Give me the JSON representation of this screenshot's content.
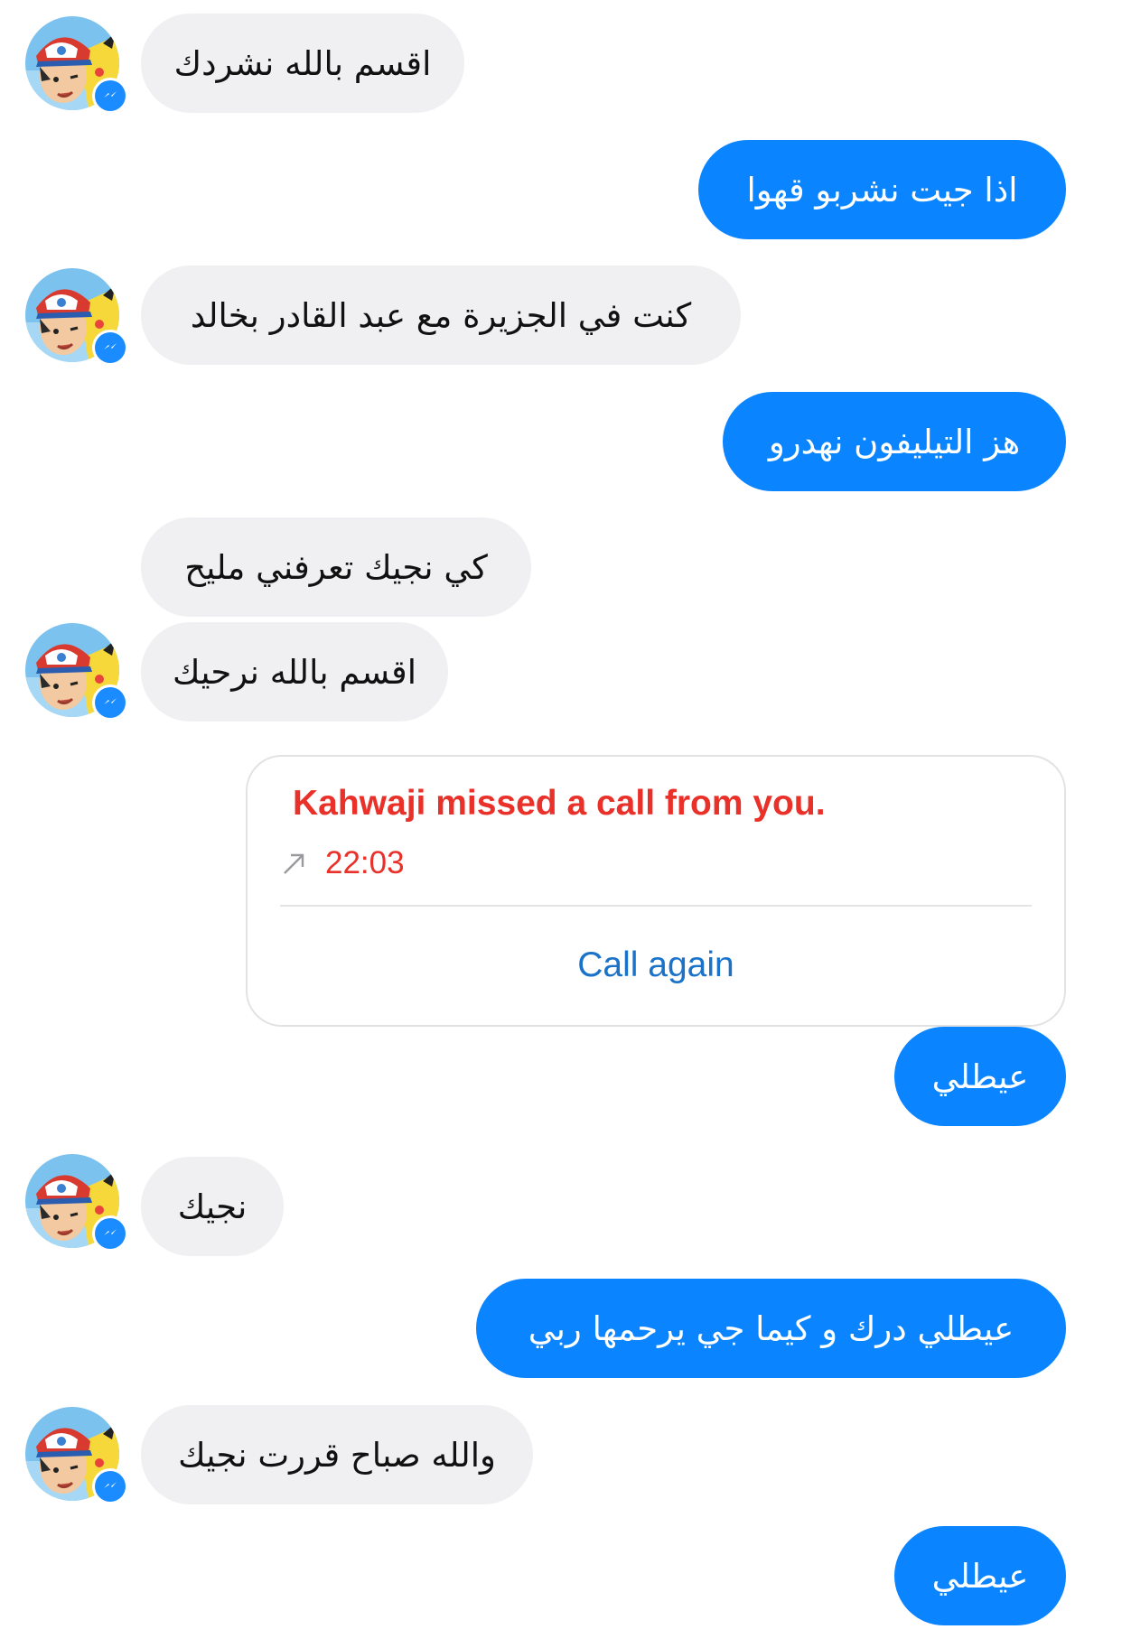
{
  "messages": [
    {
      "side": "incoming",
      "text": "اقسم بالله نشردك"
    },
    {
      "side": "outgoing",
      "text": "اذا جيت نشربو قهوا"
    },
    {
      "side": "incoming",
      "text": "كنت في الجزيرة مع عبد القادر بخالد"
    },
    {
      "side": "outgoing",
      "text": "هز التيليفون نهدرو"
    },
    {
      "side": "incoming",
      "text": "كي نجيك تعرفني مليح"
    },
    {
      "side": "incoming",
      "text": "اقسم بالله نرحيك"
    },
    {
      "side": "outgoing",
      "text": "عيطلي"
    },
    {
      "side": "incoming",
      "text": "نجيك"
    },
    {
      "side": "outgoing",
      "text": "عيطلي درك و كيما جي يرحمها ربي"
    },
    {
      "side": "incoming",
      "text": "والله صباح قررت نجيك"
    },
    {
      "side": "outgoing",
      "text": "عيطلي"
    }
  ],
  "call_card": {
    "title": "Kahwaji missed a call from you.",
    "time": "22:03",
    "direction_icon": "outgoing-call-arrow-icon",
    "action_label": "Call again"
  },
  "avatar": {
    "icon": "contact-avatar-icon",
    "badge_icon": "messenger-badge-icon"
  },
  "colors": {
    "outgoing_bubble": "#0a84ff",
    "incoming_bubble": "#f0eff1",
    "missed_call_text": "#e9312a",
    "call_again_text": "#1a72c9"
  }
}
